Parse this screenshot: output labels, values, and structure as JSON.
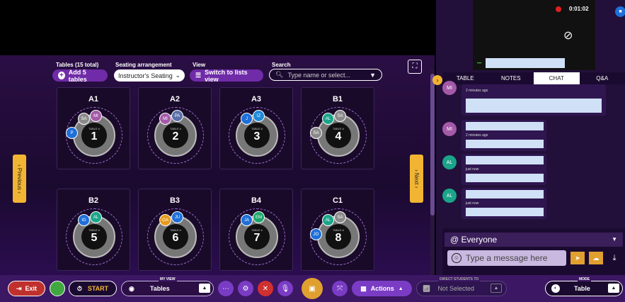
{
  "video": {
    "timer": "0:01:02"
  },
  "toolbar": {
    "tables_label": "Tables (15 total)",
    "add_tables": "Add 5 tables",
    "seating_label": "Seating arrangement",
    "seating_value": "Instructor's Seating",
    "view_label": "View",
    "switch_view": "Switch to lists view",
    "search_label": "Search",
    "search_placeholder": "Type name or select..."
  },
  "nav": {
    "previous": "Previous",
    "next": "Next"
  },
  "table_word": "TABLE #",
  "tables": [
    {
      "name": "A1",
      "number": "1",
      "seats": [
        {
          "i": "SA",
          "c": "#8a8a8a"
        },
        {
          "i": "MI",
          "c": "#a45aa8"
        },
        {
          "i": "P",
          "c": "#1e6fd9"
        }
      ]
    },
    {
      "name": "A2",
      "number": "2",
      "seats": [
        {
          "i": "MI",
          "c": "#a45aa8"
        },
        {
          "i": "PA",
          "c": "#5a6fa8"
        }
      ]
    },
    {
      "name": "A3",
      "number": "3",
      "seats": [
        {
          "i": "J",
          "c": "#1e6fd9"
        },
        {
          "i": "IZ",
          "c": "#1e8ad9"
        }
      ]
    },
    {
      "name": "B1",
      "number": "4",
      "seats": [
        {
          "i": "AL",
          "c": "#1aa58a"
        },
        {
          "i": "SA",
          "c": "#8a8a8a"
        },
        {
          "i": "SA",
          "c": "#8a8a8a"
        }
      ]
    },
    {
      "name": "B2",
      "number": "5",
      "seats": [
        {
          "i": "IG",
          "c": "#1e6fd9"
        },
        {
          "i": "AL",
          "c": "#1aa58a"
        }
      ]
    },
    {
      "name": "B3",
      "number": "6",
      "seats": [
        {
          "i": "OA",
          "c": "#e79a1c"
        },
        {
          "i": "JU",
          "c": "#1e6fd9"
        }
      ]
    },
    {
      "name": "B4",
      "number": "7",
      "seats": [
        {
          "i": "JA",
          "c": "#1e6fd9"
        },
        {
          "i": "EM",
          "c": "#1aa56a"
        }
      ]
    },
    {
      "name": "C1",
      "number": "8",
      "seats": [
        {
          "i": "AL",
          "c": "#1aa58a"
        },
        {
          "i": "SA",
          "c": "#8a8a8a"
        },
        {
          "i": "JO",
          "c": "#1e6fd9"
        }
      ]
    }
  ],
  "tabs": [
    "TABLE",
    "NOTES",
    "CHAT",
    "Q&A"
  ],
  "chat": {
    "messages": [
      {
        "initials": "MI",
        "time": "2 minutes ago"
      },
      {
        "initials": "MI",
        "time": "2 minutes ago"
      },
      {
        "initials": "AL",
        "time": "just now"
      },
      {
        "initials": "AL",
        "time": "just now"
      }
    ],
    "recipient": "@ Everyone",
    "placeholder": "Type a message here"
  },
  "bottom": {
    "exit": "Exit",
    "start": "START",
    "myview_label": "MY VIEW",
    "myview_value": "Tables",
    "actions": "Actions",
    "direct_label": "DIRECT STUDENTS TO",
    "direct_value": "Not Selected",
    "mode_label": "MODE",
    "mode_value": "Table"
  },
  "colors": {
    "accent": "#7a3cc4",
    "brand_yellow": "#f2b533",
    "bar": "#3c1763"
  }
}
